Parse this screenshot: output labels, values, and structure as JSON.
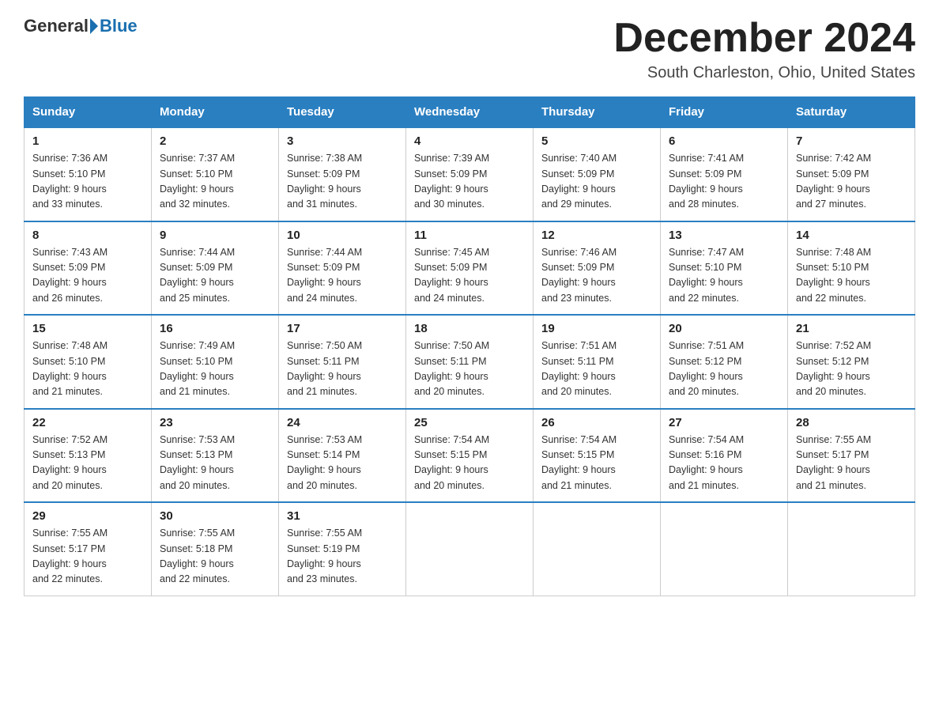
{
  "header": {
    "logo_general": "General",
    "logo_blue": "Blue",
    "month_title": "December 2024",
    "location": "South Charleston, Ohio, United States"
  },
  "weekdays": [
    "Sunday",
    "Monday",
    "Tuesday",
    "Wednesday",
    "Thursday",
    "Friday",
    "Saturday"
  ],
  "weeks": [
    [
      {
        "day": "1",
        "sunrise": "7:36 AM",
        "sunset": "5:10 PM",
        "daylight": "9 hours and 33 minutes."
      },
      {
        "day": "2",
        "sunrise": "7:37 AM",
        "sunset": "5:10 PM",
        "daylight": "9 hours and 32 minutes."
      },
      {
        "day": "3",
        "sunrise": "7:38 AM",
        "sunset": "5:09 PM",
        "daylight": "9 hours and 31 minutes."
      },
      {
        "day": "4",
        "sunrise": "7:39 AM",
        "sunset": "5:09 PM",
        "daylight": "9 hours and 30 minutes."
      },
      {
        "day": "5",
        "sunrise": "7:40 AM",
        "sunset": "5:09 PM",
        "daylight": "9 hours and 29 minutes."
      },
      {
        "day": "6",
        "sunrise": "7:41 AM",
        "sunset": "5:09 PM",
        "daylight": "9 hours and 28 minutes."
      },
      {
        "day": "7",
        "sunrise": "7:42 AM",
        "sunset": "5:09 PM",
        "daylight": "9 hours and 27 minutes."
      }
    ],
    [
      {
        "day": "8",
        "sunrise": "7:43 AM",
        "sunset": "5:09 PM",
        "daylight": "9 hours and 26 minutes."
      },
      {
        "day": "9",
        "sunrise": "7:44 AM",
        "sunset": "5:09 PM",
        "daylight": "9 hours and 25 minutes."
      },
      {
        "day": "10",
        "sunrise": "7:44 AM",
        "sunset": "5:09 PM",
        "daylight": "9 hours and 24 minutes."
      },
      {
        "day": "11",
        "sunrise": "7:45 AM",
        "sunset": "5:09 PM",
        "daylight": "9 hours and 24 minutes."
      },
      {
        "day": "12",
        "sunrise": "7:46 AM",
        "sunset": "5:09 PM",
        "daylight": "9 hours and 23 minutes."
      },
      {
        "day": "13",
        "sunrise": "7:47 AM",
        "sunset": "5:10 PM",
        "daylight": "9 hours and 22 minutes."
      },
      {
        "day": "14",
        "sunrise": "7:48 AM",
        "sunset": "5:10 PM",
        "daylight": "9 hours and 22 minutes."
      }
    ],
    [
      {
        "day": "15",
        "sunrise": "7:48 AM",
        "sunset": "5:10 PM",
        "daylight": "9 hours and 21 minutes."
      },
      {
        "day": "16",
        "sunrise": "7:49 AM",
        "sunset": "5:10 PM",
        "daylight": "9 hours and 21 minutes."
      },
      {
        "day": "17",
        "sunrise": "7:50 AM",
        "sunset": "5:11 PM",
        "daylight": "9 hours and 21 minutes."
      },
      {
        "day": "18",
        "sunrise": "7:50 AM",
        "sunset": "5:11 PM",
        "daylight": "9 hours and 20 minutes."
      },
      {
        "day": "19",
        "sunrise": "7:51 AM",
        "sunset": "5:11 PM",
        "daylight": "9 hours and 20 minutes."
      },
      {
        "day": "20",
        "sunrise": "7:51 AM",
        "sunset": "5:12 PM",
        "daylight": "9 hours and 20 minutes."
      },
      {
        "day": "21",
        "sunrise": "7:52 AM",
        "sunset": "5:12 PM",
        "daylight": "9 hours and 20 minutes."
      }
    ],
    [
      {
        "day": "22",
        "sunrise": "7:52 AM",
        "sunset": "5:13 PM",
        "daylight": "9 hours and 20 minutes."
      },
      {
        "day": "23",
        "sunrise": "7:53 AM",
        "sunset": "5:13 PM",
        "daylight": "9 hours and 20 minutes."
      },
      {
        "day": "24",
        "sunrise": "7:53 AM",
        "sunset": "5:14 PM",
        "daylight": "9 hours and 20 minutes."
      },
      {
        "day": "25",
        "sunrise": "7:54 AM",
        "sunset": "5:15 PM",
        "daylight": "9 hours and 20 minutes."
      },
      {
        "day": "26",
        "sunrise": "7:54 AM",
        "sunset": "5:15 PM",
        "daylight": "9 hours and 21 minutes."
      },
      {
        "day": "27",
        "sunrise": "7:54 AM",
        "sunset": "5:16 PM",
        "daylight": "9 hours and 21 minutes."
      },
      {
        "day": "28",
        "sunrise": "7:55 AM",
        "sunset": "5:17 PM",
        "daylight": "9 hours and 21 minutes."
      }
    ],
    [
      {
        "day": "29",
        "sunrise": "7:55 AM",
        "sunset": "5:17 PM",
        "daylight": "9 hours and 22 minutes."
      },
      {
        "day": "30",
        "sunrise": "7:55 AM",
        "sunset": "5:18 PM",
        "daylight": "9 hours and 22 minutes."
      },
      {
        "day": "31",
        "sunrise": "7:55 AM",
        "sunset": "5:19 PM",
        "daylight": "9 hours and 23 minutes."
      },
      null,
      null,
      null,
      null
    ]
  ]
}
